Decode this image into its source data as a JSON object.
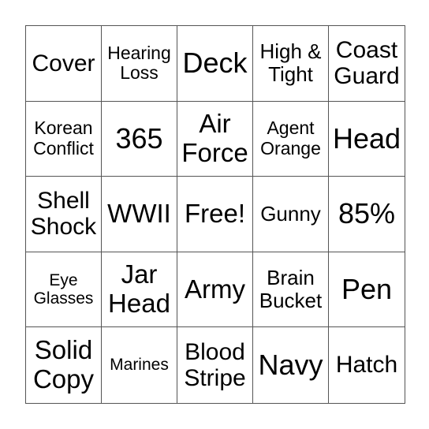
{
  "card": {
    "cells": [
      {
        "text": "Cover",
        "size": "s-m"
      },
      {
        "text": "Hearing\nLoss",
        "size": "s-xs"
      },
      {
        "text": "Deck",
        "size": "s-xl"
      },
      {
        "text": "High &\nTight",
        "size": "s-s"
      },
      {
        "text": "Coast\nGuard",
        "size": "s-m"
      },
      {
        "text": "Korean\nConflict",
        "size": "s-xs"
      },
      {
        "text": "365",
        "size": "s-xl"
      },
      {
        "text": "Air\nForce",
        "size": "s-l"
      },
      {
        "text": "Agent\nOrange",
        "size": "s-xs"
      },
      {
        "text": "Head",
        "size": "s-xl"
      },
      {
        "text": "Shell\nShock",
        "size": "s-m"
      },
      {
        "text": "WWII",
        "size": "s-l"
      },
      {
        "text": "Free!",
        "size": "s-l"
      },
      {
        "text": "Gunny",
        "size": "s-s"
      },
      {
        "text": "85%",
        "size": "s-xl"
      },
      {
        "text": "Eye\nGlasses",
        "size": "s-xxs"
      },
      {
        "text": "Jar\nHead",
        "size": "s-l"
      },
      {
        "text": "Army",
        "size": "s-l"
      },
      {
        "text": "Brain\nBucket",
        "size": "s-s"
      },
      {
        "text": "Pen",
        "size": "s-xl"
      },
      {
        "text": "Solid\nCopy",
        "size": "s-l"
      },
      {
        "text": "Marines",
        "size": "s-xxs"
      },
      {
        "text": "Blood\nStripe",
        "size": "s-m"
      },
      {
        "text": "Navy",
        "size": "s-xl"
      },
      {
        "text": "Hatch",
        "size": "s-m"
      }
    ]
  }
}
